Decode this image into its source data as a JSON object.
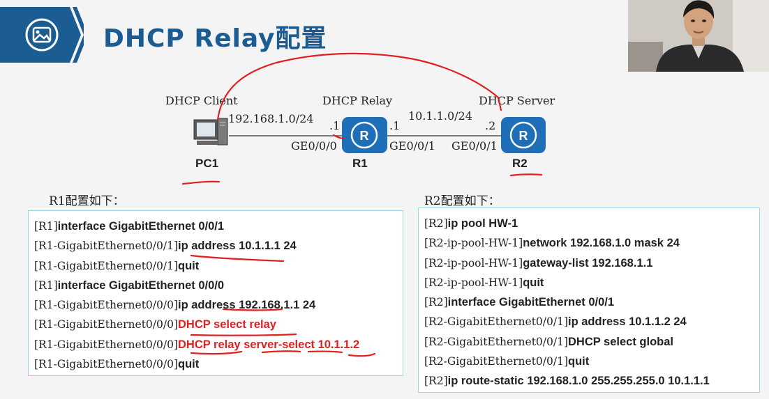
{
  "title": "DHCP Relay配置",
  "diagram": {
    "roles": {
      "client": "DHCP Client",
      "relay": "DHCP Relay",
      "server": "DHCP Server"
    },
    "networks": {
      "left": "192.168.1.0/24",
      "right": "10.1.1.0/24"
    },
    "addr": {
      "r1_left": ".1",
      "r1_right": ".1",
      "r2_left": ".2"
    },
    "ports": {
      "r1_left": "GE0/0/0",
      "r1_right": "GE0/0/1",
      "r2_left": "GE0/0/1"
    },
    "devices": {
      "pc": "PC1",
      "r1": "R1",
      "r2": "R2"
    },
    "router_icon": "R"
  },
  "r1": {
    "heading": "R1配置如下：",
    "lines": [
      {
        "prompt": "[R1]",
        "cmd": "interface GigabitEthernet 0/0/1",
        "highlight": false
      },
      {
        "prompt": "[R1-GigabitEthernet0/0/1]",
        "cmd": "ip address 10.1.1.1 24",
        "highlight": false
      },
      {
        "prompt": "[R1-GigabitEthernet0/0/1]",
        "cmd": "quit",
        "highlight": false
      },
      {
        "prompt": "[R1]",
        "cmd": "interface GigabitEthernet 0/0/0",
        "highlight": false
      },
      {
        "prompt": "[R1-GigabitEthernet0/0/0]",
        "cmd": "ip address 192.168.1.1 24",
        "highlight": false
      },
      {
        "prompt": "[R1-GigabitEthernet0/0/0]",
        "cmd": "DHCP select relay",
        "highlight": true
      },
      {
        "prompt": "[R1-GigabitEthernet0/0/0]",
        "cmd": "DHCP relay server-select 10.1.1.2",
        "highlight": true
      },
      {
        "prompt": "[R1-GigabitEthernet0/0/0]",
        "cmd": "quit",
        "highlight": false
      }
    ]
  },
  "r2": {
    "heading": "R2配置如下：",
    "lines": [
      {
        "prompt": "[R2]",
        "cmd": "ip pool HW-1",
        "highlight": false
      },
      {
        "prompt": "[R2-ip-pool-HW-1]",
        "cmd": "network 192.168.1.0 mask 24",
        "highlight": false
      },
      {
        "prompt": "[R2-ip-pool-HW-1]",
        "cmd": "gateway-list 192.168.1.1",
        "highlight": false
      },
      {
        "prompt": "[R2-ip-pool-HW-1]",
        "cmd": "quit",
        "highlight": false
      },
      {
        "prompt": "[R2]",
        "cmd": "interface GigabitEthernet 0/0/1",
        "highlight": false
      },
      {
        "prompt": "[R2-GigabitEthernet0/0/1]",
        "cmd": "ip address 10.1.1.2 24",
        "highlight": false
      },
      {
        "prompt": "[R2-GigabitEthernet0/0/1]",
        "cmd": "DHCP select global",
        "highlight": false
      },
      {
        "prompt": "[R2-GigabitEthernet0/0/1]",
        "cmd": "quit",
        "highlight": false
      },
      {
        "prompt": "[R2]",
        "cmd": "ip route-static 192.168.1.0 255.255.255.0 10.1.1.1",
        "highlight": false
      }
    ]
  },
  "colors": {
    "brand": "#1b5c93",
    "router": "#1f6fb8",
    "box_border": "#9fd3e6",
    "highlight": "#e02020",
    "annotation": "#e02020"
  }
}
